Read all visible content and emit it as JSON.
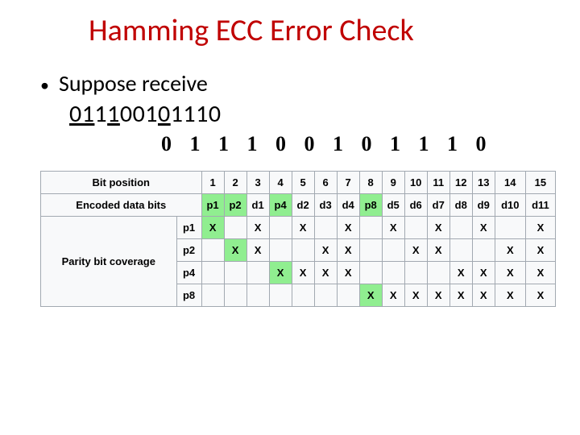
{
  "title": "Hamming ECC Error Check",
  "bullet": "Suppose receive",
  "received_bits": "011100101110",
  "bits_spaced": "0 1 1 1 0 0 1 0 1 1 1 0",
  "table": {
    "row_labels": {
      "bit_position": "Bit position",
      "encoded": "Encoded data bits",
      "parity_header": "Parity bit coverage",
      "p1": "p1",
      "p2": "p2",
      "p4": "p4",
      "p8": "p8"
    },
    "positions": [
      "1",
      "2",
      "3",
      "4",
      "5",
      "6",
      "7",
      "8",
      "9",
      "10",
      "11",
      "12",
      "13",
      "14",
      "15"
    ],
    "encoded": [
      "p1",
      "p2",
      "d1",
      "p4",
      "d2",
      "d3",
      "d4",
      "p8",
      "d5",
      "d6",
      "d7",
      "d8",
      "d9",
      "d10",
      "d11"
    ],
    "parity_green": [
      0,
      1,
      3,
      7
    ],
    "coverage": {
      "p1": [
        1,
        3,
        5,
        7,
        9,
        11,
        13,
        15
      ],
      "p2": [
        2,
        3,
        6,
        7,
        10,
        11,
        14,
        15
      ],
      "p4": [
        4,
        5,
        6,
        7,
        12,
        13,
        14,
        15
      ],
      "p8": [
        8,
        9,
        10,
        11,
        12,
        13,
        14,
        15
      ]
    }
  }
}
